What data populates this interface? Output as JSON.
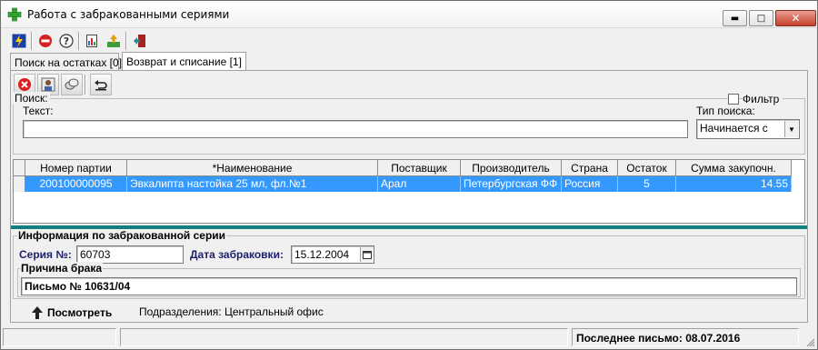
{
  "window": {
    "title": "Работа с забракованными сериями"
  },
  "icons": {
    "app": "green-cross-icon",
    "toolbar": [
      "lightning-icon",
      "stop-icon",
      "help-icon",
      "report-icon",
      "export-icon",
      "exit-door-icon"
    ],
    "panel_toolbar": [
      "delete-icon",
      "user-icon",
      "pills-icon",
      "undo-icon"
    ]
  },
  "tabs": [
    {
      "label": "Поиск на остатках [0]"
    },
    {
      "label": "Возврат и списание [1]"
    }
  ],
  "search": {
    "group_label": "Поиск:",
    "filter_label": "Фильтр",
    "filter_checked": false,
    "text_label": "Текст:",
    "text_value": "",
    "search_type_label": "Тип поиска:",
    "search_type_value": "Начинается с"
  },
  "table": {
    "columns": [
      "Номер партии",
      "*Наименование",
      "Поставщик",
      "Производитель",
      "Страна",
      "Остаток",
      "Сумма закупочн."
    ],
    "rows": [
      [
        "200100000095",
        "Эвкалипта настойка 25 мл, фл.№1",
        "Арал",
        "Петербургская ФФ",
        "Россия",
        "5",
        "14.55"
      ]
    ]
  },
  "info": {
    "group_label": "Информация по забракованной серии",
    "series_label": "Серия №:",
    "series_value": "60703",
    "reject_date_label": "Дата забраковки:",
    "reject_date_value": "15.12.2004",
    "reason_label": "Причина брака",
    "reason_value": "Письмо № 10631/04"
  },
  "footer": {
    "view_button": "Посмотреть",
    "departments": "Подразделения: Центральный офис"
  },
  "status": {
    "last_letter": "Последнее письмо: 08.07.2016"
  },
  "colors": {
    "selection": "#3399ff",
    "teal_bar": "#0f7f80",
    "label_navy": "#1e1e6e"
  }
}
